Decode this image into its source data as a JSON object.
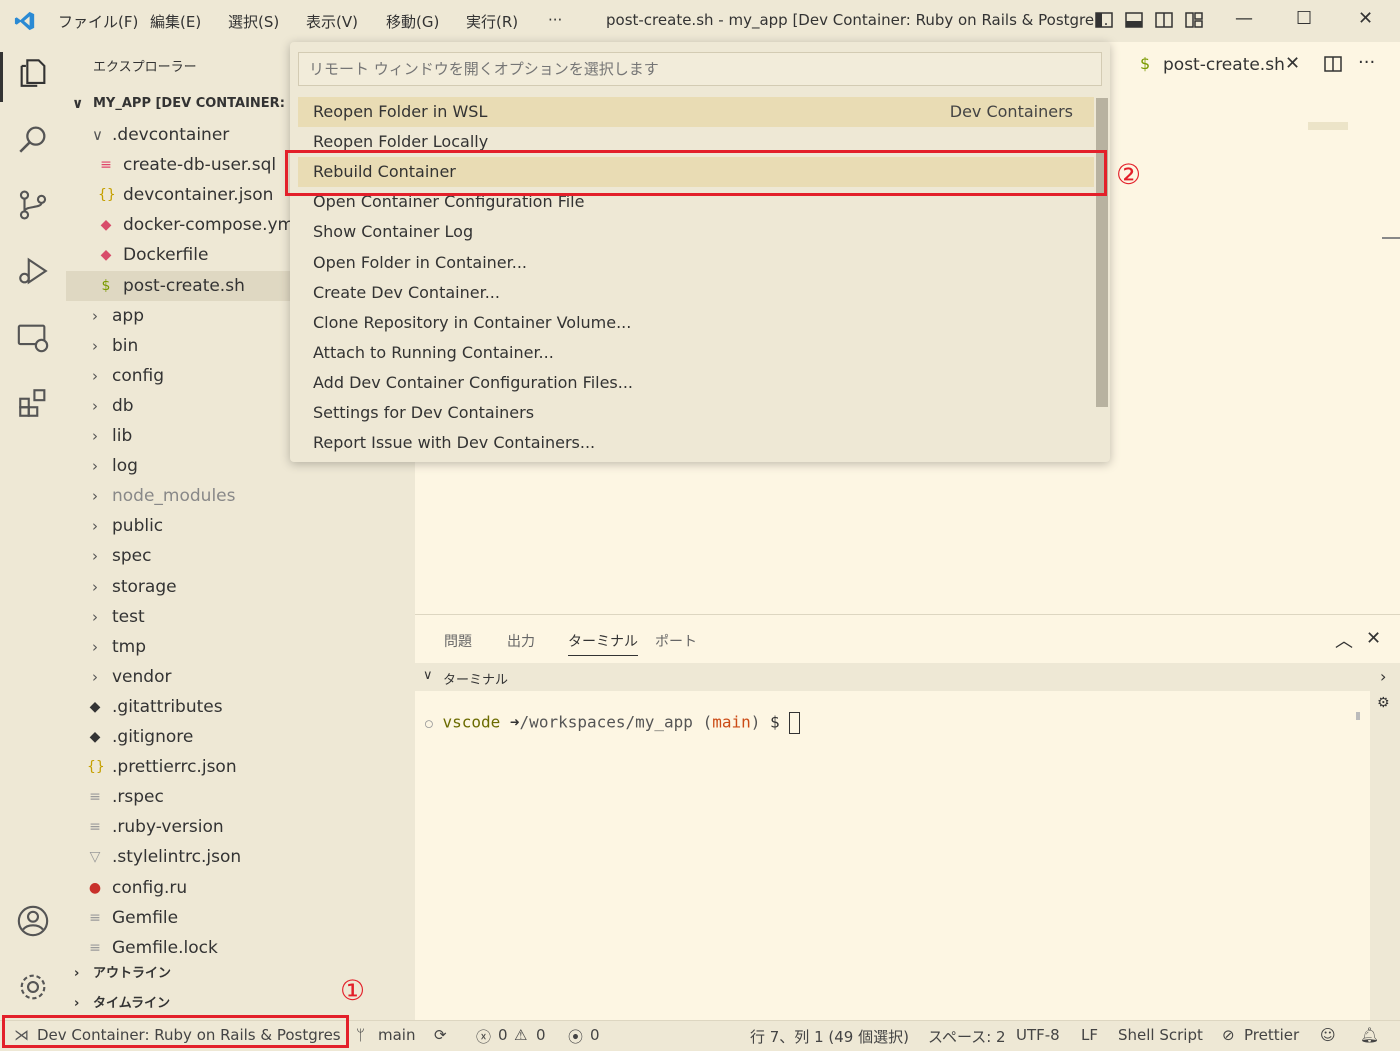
{
  "titlebar": {
    "menus": [
      "ファイル(F)",
      "編集(E)",
      "選択(S)",
      "表示(V)",
      "移動(G)",
      "実行(R)",
      "···"
    ],
    "window_title": "post-create.sh - my_app [Dev Container: Ruby on Rails & Postgre..."
  },
  "sidebar": {
    "header": "エクスプローラー",
    "root_label": "MY_APP [DEV CONTAINER:",
    "items": [
      {
        "label": ".devcontainer",
        "kind": "folder-open"
      },
      {
        "label": "create-db-user.sql",
        "kind": "sql"
      },
      {
        "label": "devcontainer.json",
        "kind": "json"
      },
      {
        "label": "docker-compose.yml",
        "kind": "docker"
      },
      {
        "label": "Dockerfile",
        "kind": "docker"
      },
      {
        "label": "post-create.sh",
        "kind": "shell"
      },
      {
        "label": "app",
        "kind": "folder"
      },
      {
        "label": "bin",
        "kind": "folder"
      },
      {
        "label": "config",
        "kind": "folder"
      },
      {
        "label": "db",
        "kind": "folder"
      },
      {
        "label": "lib",
        "kind": "folder"
      },
      {
        "label": "log",
        "kind": "folder"
      },
      {
        "label": "node_modules",
        "kind": "folder"
      },
      {
        "label": "public",
        "kind": "folder"
      },
      {
        "label": "spec",
        "kind": "folder"
      },
      {
        "label": "storage",
        "kind": "folder"
      },
      {
        "label": "test",
        "kind": "folder"
      },
      {
        "label": "tmp",
        "kind": "folder"
      },
      {
        "label": "vendor",
        "kind": "folder"
      },
      {
        "label": ".gitattributes",
        "kind": "git"
      },
      {
        "label": ".gitignore",
        "kind": "git"
      },
      {
        "label": ".prettierrc.json",
        "kind": "json"
      },
      {
        "label": ".rspec",
        "kind": "text"
      },
      {
        "label": ".ruby-version",
        "kind": "text"
      },
      {
        "label": ".stylelintrc.json",
        "kind": "stylelint"
      },
      {
        "label": "config.ru",
        "kind": "ruby"
      },
      {
        "label": "Gemfile",
        "kind": "text"
      },
      {
        "label": "Gemfile.lock",
        "kind": "text"
      }
    ],
    "outline_label": "アウトライン",
    "timeline_label": "タイムライン"
  },
  "editor": {
    "tab_label": "post-create.sh",
    "tab_icon": "$"
  },
  "quickpick": {
    "placeholder": "リモート ウィンドウを開くオプションを選択します",
    "items": [
      {
        "label": "Reopen Folder in WSL",
        "detail": "Dev Containers"
      },
      {
        "label": "Reopen Folder Locally",
        "detail": ""
      },
      {
        "label": "Rebuild Container",
        "detail": ""
      },
      {
        "label": "Open Container Configuration File",
        "detail": ""
      },
      {
        "label": "Show Container Log",
        "detail": ""
      },
      {
        "label": "Open Folder in Container...",
        "detail": ""
      },
      {
        "label": "Create Dev Container...",
        "detail": ""
      },
      {
        "label": "Clone Repository in Container Volume...",
        "detail": ""
      },
      {
        "label": "Attach to Running Container...",
        "detail": ""
      },
      {
        "label": "Add Dev Container Configuration Files...",
        "detail": ""
      },
      {
        "label": "Settings for Dev Containers",
        "detail": ""
      },
      {
        "label": "Report Issue with Dev Containers...",
        "detail": ""
      }
    ]
  },
  "annotations": {
    "marker_1": "①",
    "marker_2": "②"
  },
  "panel": {
    "tabs": [
      "問題",
      "出力",
      "ターミナル",
      "ポート"
    ],
    "active_tab": "ターミナル",
    "section_label": "ターミナル",
    "prompt_user": "vscode",
    "prompt_arrow": "➜",
    "prompt_path": "/workspaces/my_app",
    "prompt_branch_open": "(",
    "prompt_branch": "main",
    "prompt_branch_close": ")",
    "prompt_symbol": "$"
  },
  "statusbar": {
    "remote": "Dev Container: Ruby on Rails & Postgres",
    "branch": "main",
    "errors": "0",
    "warnings": "0",
    "ports": "0",
    "cursor": "行 7、列 1 (49 個選択)",
    "spaces": "スペース: 2",
    "encoding": "UTF-8",
    "eol": "LF",
    "language": "Shell Script",
    "formatter": "Prettier"
  },
  "colors": {
    "accent_red": "#e3202a",
    "background": "#fdf6e3",
    "bar": "#eee8d5"
  }
}
